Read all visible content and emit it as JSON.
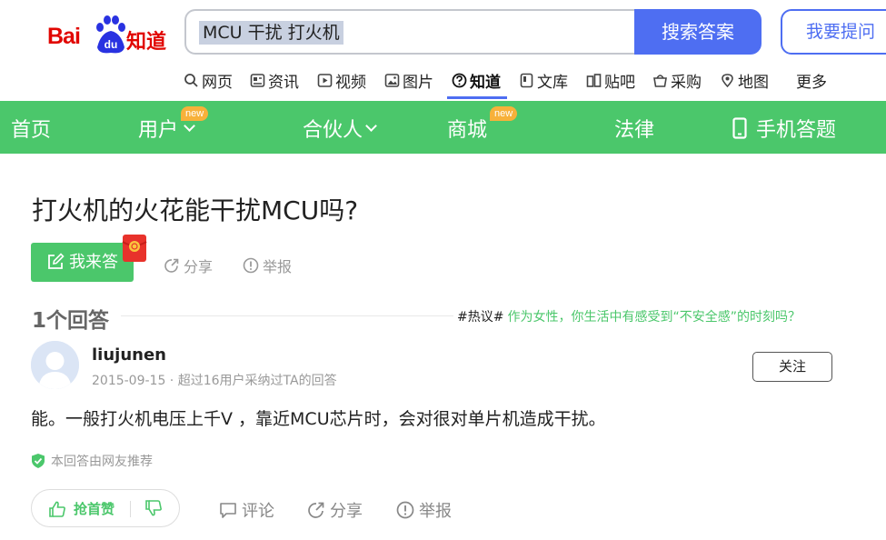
{
  "header": {
    "logo_text_bai": "Bai",
    "logo_text_du": "du",
    "logo_text_zhidao": "知道",
    "search_value": "MCU 干扰 打火机",
    "search_button": "搜索答案",
    "ask_button": "我要提问"
  },
  "nav": {
    "items": [
      {
        "label": "网页",
        "icon": "search-icon"
      },
      {
        "label": "资讯",
        "icon": "news-icon"
      },
      {
        "label": "视频",
        "icon": "video-icon"
      },
      {
        "label": "图片",
        "icon": "image-icon"
      },
      {
        "label": "知道",
        "icon": "question-icon",
        "active": true
      },
      {
        "label": "文库",
        "icon": "doc-icon"
      },
      {
        "label": "贴吧",
        "icon": "tieba-icon"
      },
      {
        "label": "采购",
        "icon": "basket-icon"
      },
      {
        "label": "地图",
        "icon": "map-pin-icon"
      },
      {
        "label": "更多",
        "icon": ""
      }
    ]
  },
  "greenbar": {
    "items": [
      {
        "label": "首页"
      },
      {
        "label": "用户",
        "badge": "new",
        "dropdown": true
      },
      {
        "label": "合伙人",
        "dropdown": true
      },
      {
        "label": "商城",
        "badge": "new"
      },
      {
        "label": "法律"
      },
      {
        "label": "手机答题",
        "icon": "phone-icon"
      }
    ]
  },
  "question": {
    "title": "打火机的火花能干扰MCU吗?",
    "answer_button": "我来答",
    "share": "分享",
    "report": "举报"
  },
  "answers": {
    "count_label": "1个回答",
    "hot_tag": "#热议#",
    "hot_link": "作为女性，你生活中有感受到“不安全感”的时刻吗？"
  },
  "answer": {
    "username": "liujunen",
    "meta": "2015-09-15 · 超过16用户采纳过TA的回答",
    "follow": "关注",
    "body": "能。一般打火机电压上千V ，靠近MCU芯片时，会对很对单片机造成干扰。",
    "recommend": "本回答由网友推荐",
    "upvote": "抢首赞",
    "comment": "评论",
    "share": "分享",
    "report": "举报"
  },
  "colors": {
    "accent_blue": "#4e6ef2",
    "green": "#4bc76b",
    "logo_red": "#e10601",
    "badge_orange": "#f7b13a"
  }
}
